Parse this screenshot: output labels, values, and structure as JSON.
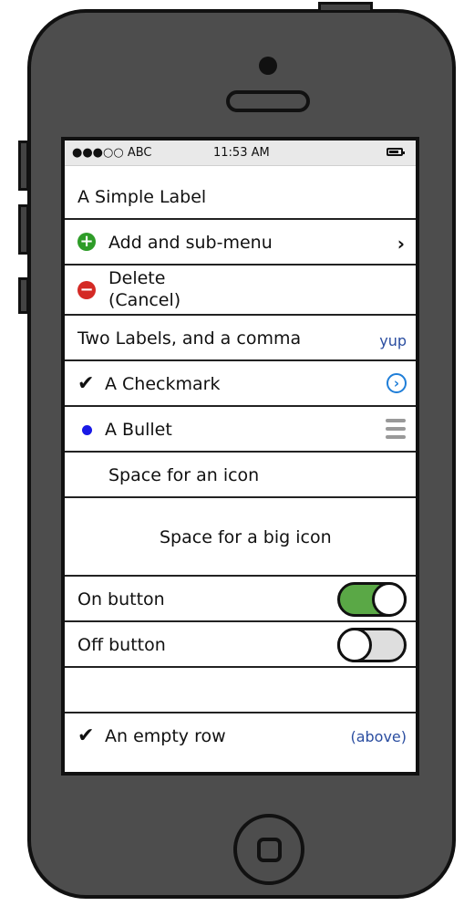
{
  "status_bar": {
    "carrier": "●●●○○ ABC",
    "time": "11:53 AM"
  },
  "rows": {
    "simple_label": "A Simple Label",
    "add_submenu": "Add and sub-menu",
    "delete_line1": "Delete",
    "delete_line2": "(Cancel)",
    "two_labels": "Two Labels, and a comma",
    "two_labels_detail": "yup",
    "checkmark": "A Checkmark",
    "bullet": "A Bullet",
    "space_icon": "Space for an icon",
    "space_big_icon": "Space for a big icon",
    "on_button": "On button",
    "off_button": "Off button",
    "empty_row_label": "An empty row",
    "empty_row_detail": "(above)"
  },
  "toggles": {
    "on_button_state": true,
    "off_button_state": false
  },
  "icons": {
    "add": "plus-circle-icon",
    "delete": "minus-circle-icon",
    "submenu": "chevron-right-icon",
    "checkmark": "checkmark-icon",
    "disclosure": "disclosure-chevron-icon",
    "bullet": "bullet-icon",
    "reorder": "reorder-handle-icon"
  },
  "colors": {
    "accent": "#1f7ed8",
    "toggle_on": "#5aa846",
    "add_green": "#2e9c28",
    "delete_red": "#d42a25",
    "bullet_blue": "#1919e6",
    "detail_text": "#2a4da0"
  }
}
